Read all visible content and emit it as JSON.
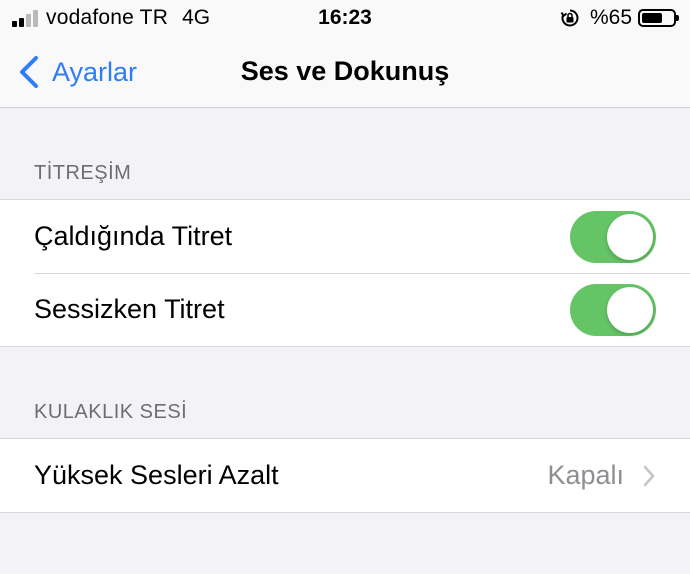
{
  "status_bar": {
    "carrier": "vodafone TR",
    "network": "4G",
    "time": "16:23",
    "battery_percent": "%65",
    "battery_level": 0.65,
    "icons": [
      "signal-bars-icon",
      "rotation-lock-icon",
      "battery-icon"
    ]
  },
  "nav": {
    "back_label": "Ayarlar",
    "title": "Ses ve Dokunuş"
  },
  "sections": {
    "vibration": {
      "header": "TİTREŞİM",
      "rows": [
        {
          "label": "Çaldığında Titret",
          "toggle_on": true
        },
        {
          "label": "Sessizken Titret",
          "toggle_on": true
        }
      ]
    },
    "headphone": {
      "header": "KULAKLIK SESİ",
      "rows": [
        {
          "label": "Yüksek Sesleri Azalt",
          "value": "Kapalı"
        }
      ]
    }
  },
  "colors": {
    "accent_blue": "#2f7cf6",
    "toggle_green": "#65c466",
    "background": "#f2f2f7",
    "secondary_text": "#8e8e93"
  }
}
